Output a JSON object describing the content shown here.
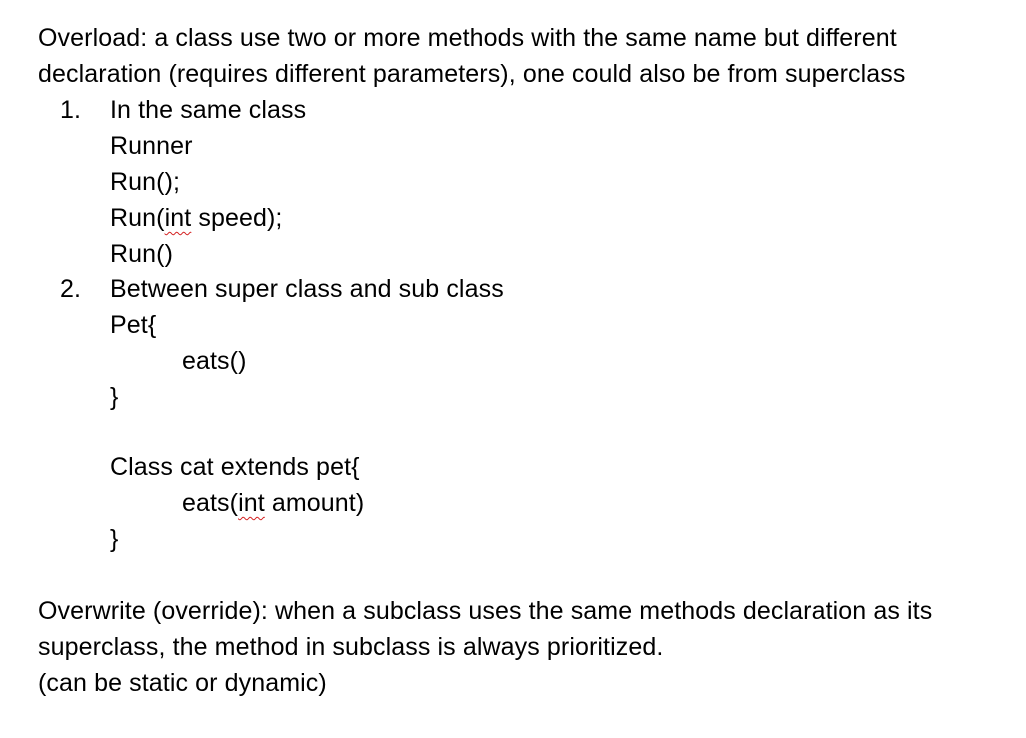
{
  "overload": {
    "line1": "Overload: a class use two or more methods with the same name but different",
    "line2": "declaration (requires different parameters), one could also be from superclass"
  },
  "item1": {
    "number": "1.",
    "title": "In the same class",
    "code": {
      "l1": "Runner",
      "l2": "Run();",
      "l3_pre": "Run(",
      "l3_kw": "int",
      "l3_post": " speed);",
      "l4": "Run()"
    }
  },
  "item2": {
    "number": "2.",
    "title": "Between super class and sub class",
    "code": {
      "pet_open": "Pet{",
      "pet_method": "eats()",
      "pet_close": "}",
      "cat_open": "Class cat extends pet{",
      "cat_method_pre": "eats(",
      "cat_method_kw": "int",
      "cat_method_post": " amount)",
      "cat_close": "}"
    }
  },
  "overwrite": {
    "line1": "Overwrite (override): when a subclass uses the same methods declaration as its",
    "line2": "superclass, the method in subclass is always prioritized.",
    "line3": "(can be static or dynamic)"
  }
}
